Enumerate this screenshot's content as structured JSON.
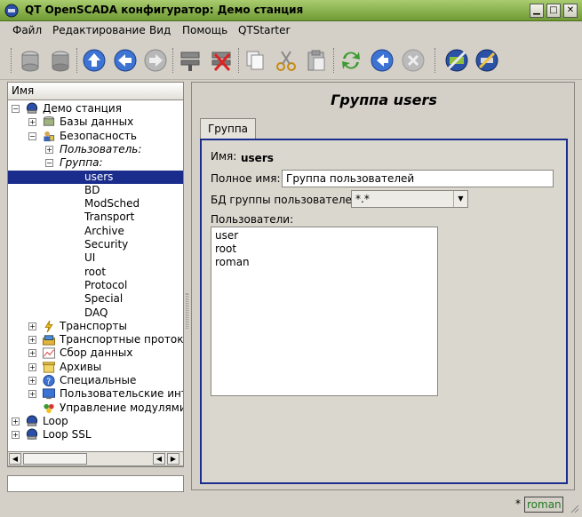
{
  "window": {
    "title": "QT OpenSCADA конфигуратор: Демо станция"
  },
  "menu": [
    {
      "label": "Файл"
    },
    {
      "label": "Редактирование"
    },
    {
      "label": "Вид"
    },
    {
      "label": "Помощь"
    },
    {
      "label": "QTStarter"
    }
  ],
  "toolbar": {
    "icons": [
      "db-load-icon",
      "db-save-icon",
      "up-icon",
      "back-icon",
      "forward-icon",
      "add-item-icon",
      "delete-item-icon",
      "copy-icon",
      "cut-icon",
      "paste-icon",
      "refresh-icon",
      "start-icon",
      "stop-icon",
      "connect-icon",
      "settings-icon"
    ]
  },
  "tree": {
    "header": "Имя",
    "rows": [
      {
        "label": "Демо станция",
        "level": 0,
        "expander": "−",
        "icon": "station-icon"
      },
      {
        "label": "Базы данных",
        "level": 1,
        "expander": "+",
        "icon": "database-icon"
      },
      {
        "label": "Безопасность",
        "level": 1,
        "expander": "−",
        "icon": "security-icon"
      },
      {
        "label": "Пользователь:",
        "level": 2,
        "expander": "+",
        "italic": true
      },
      {
        "label": "Группа:",
        "level": 2,
        "expander": "−",
        "italic": true
      },
      {
        "label": "users",
        "level": 3,
        "selected": true
      },
      {
        "label": "BD",
        "level": 3
      },
      {
        "label": "ModSched",
        "level": 3
      },
      {
        "label": "Transport",
        "level": 3
      },
      {
        "label": "Archive",
        "level": 3
      },
      {
        "label": "Security",
        "level": 3
      },
      {
        "label": "UI",
        "level": 3
      },
      {
        "label": "root",
        "level": 3
      },
      {
        "label": "Protocol",
        "level": 3
      },
      {
        "label": "Special",
        "level": 3
      },
      {
        "label": "DAQ",
        "level": 3
      },
      {
        "label": "Транспорты",
        "level": 1,
        "expander": "+",
        "icon": "transport-icon"
      },
      {
        "label": "Транспортные протоко",
        "level": 1,
        "expander": "+",
        "icon": "protocol-icon"
      },
      {
        "label": "Сбор данных",
        "level": 1,
        "expander": "+",
        "icon": "daq-icon"
      },
      {
        "label": "Архивы",
        "level": 1,
        "expander": "+",
        "icon": "archive-icon"
      },
      {
        "label": "Специальные",
        "level": 1,
        "expander": "+",
        "icon": "special-icon"
      },
      {
        "label": "Пользовательские инт",
        "level": 1,
        "expander": "+",
        "icon": "ui-icon"
      },
      {
        "label": "Управление модулями",
        "level": 1,
        "icon": "modules-icon"
      },
      {
        "label": "Loop",
        "level": 0,
        "expander": "+",
        "icon": "station-icon"
      },
      {
        "label": "Loop SSL",
        "level": 0,
        "expander": "+",
        "icon": "station-icon"
      }
    ]
  },
  "page": {
    "title": "Группа users",
    "tab": "Группа",
    "name_label": "Имя:",
    "name_value": "users",
    "fullname_label": "Полное имя:",
    "fullname_value": "Группа пользователей",
    "db_label": "БД группы пользователей:",
    "db_value": "*.*",
    "users_label": "Пользователи:",
    "users": [
      "user",
      "root",
      "roman"
    ]
  },
  "status": {
    "modified_marker": "*",
    "user": "roman"
  },
  "colors": {
    "titlebar": "#8fb955",
    "selection": "#1a2d8c",
    "status_user": "#1f7a1f"
  }
}
